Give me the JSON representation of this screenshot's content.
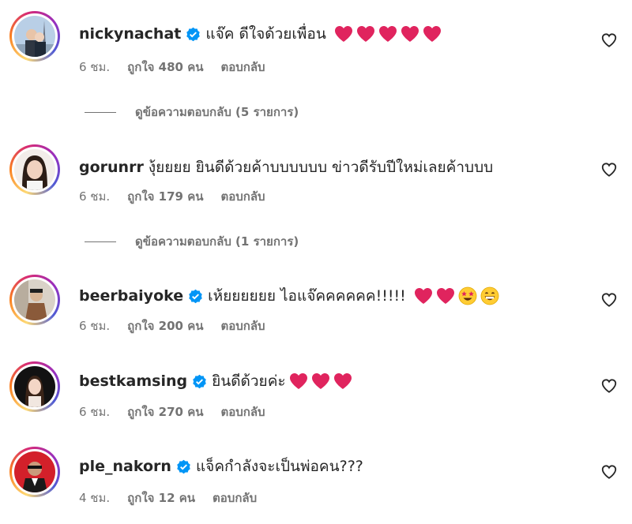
{
  "colors": {
    "username": "#262626",
    "meta": "#737373",
    "verified": "#0095f6",
    "heart": "#e0245e"
  },
  "comments": [
    {
      "username": "nickynachat",
      "verified": true,
      "text": "แจ๊ค ดีใจด้วยเพื่อน",
      "emojis": [
        "red-heart",
        "red-heart",
        "red-heart",
        "red-heart",
        "red-heart"
      ],
      "time": "6 ชม.",
      "likes": "ถูกใจ 480 คน",
      "reply": "ตอบกลับ",
      "view_replies": "ดูข้อความตอบกลับ (5 รายการ)"
    },
    {
      "username": "gorunrr",
      "verified": false,
      "text": "งุ้ยยยย ยินดีด้วยค้าบบบบบบ ข่าวดีรับปีใหม่เลยค้าบบบ",
      "emojis": [],
      "time": "6 ชม.",
      "likes": "ถูกใจ 179 คน",
      "reply": "ตอบกลับ",
      "view_replies": "ดูข้อความตอบกลับ (1 รายการ)"
    },
    {
      "username": "beerbaiyoke",
      "verified": true,
      "text": "เห้ยยยยยย ไอแจ๊คคคคคค!!!!!",
      "emojis": [
        "red-heart",
        "red-heart",
        "star-struck",
        "grinning-face"
      ],
      "time": "6 ชม.",
      "likes": "ถูกใจ 200 คน",
      "reply": "ตอบกลับ"
    },
    {
      "username": "bestkamsing",
      "verified": true,
      "text": "ยินดีด้วยค่ะ",
      "emojis": [
        "red-heart",
        "red-heart",
        "red-heart"
      ],
      "time": "6 ชม.",
      "likes": "ถูกใจ 270 คน",
      "reply": "ตอบกลับ"
    },
    {
      "username": "ple_nakorn",
      "verified": true,
      "text": "แจ็คกำลังจะเป็นพ่อคน???",
      "emojis": [],
      "time": "4 ชม.",
      "likes": "ถูกใจ 12 คน",
      "reply": "ตอบกลับ"
    }
  ]
}
